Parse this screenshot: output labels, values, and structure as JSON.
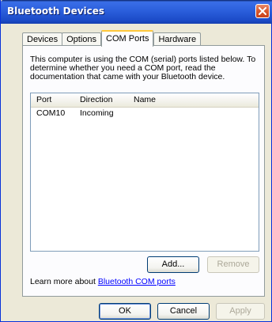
{
  "window": {
    "title": "Bluetooth Devices",
    "accent": "#2b5fdc"
  },
  "tabs": [
    {
      "label": "Devices",
      "active": false
    },
    {
      "label": "Options",
      "active": false
    },
    {
      "label": "COM Ports",
      "active": true
    },
    {
      "label": "Hardware",
      "active": false
    }
  ],
  "com_ports": {
    "description": "This computer is using the COM (serial) ports listed below. To determine whether you need a COM port, read the documentation that came with your Bluetooth device.",
    "columns": [
      "Port",
      "Direction",
      "Name"
    ],
    "rows": [
      {
        "port": "COM10",
        "direction": "Incoming",
        "name": ""
      }
    ],
    "add_label": "Add...",
    "remove_label": "Remove",
    "learn_prefix": "Learn more about ",
    "learn_link": "Bluetooth COM ports"
  },
  "footer": {
    "ok_label": "OK",
    "cancel_label": "Cancel",
    "apply_label": "Apply"
  },
  "icons": {
    "close": "close-icon"
  }
}
